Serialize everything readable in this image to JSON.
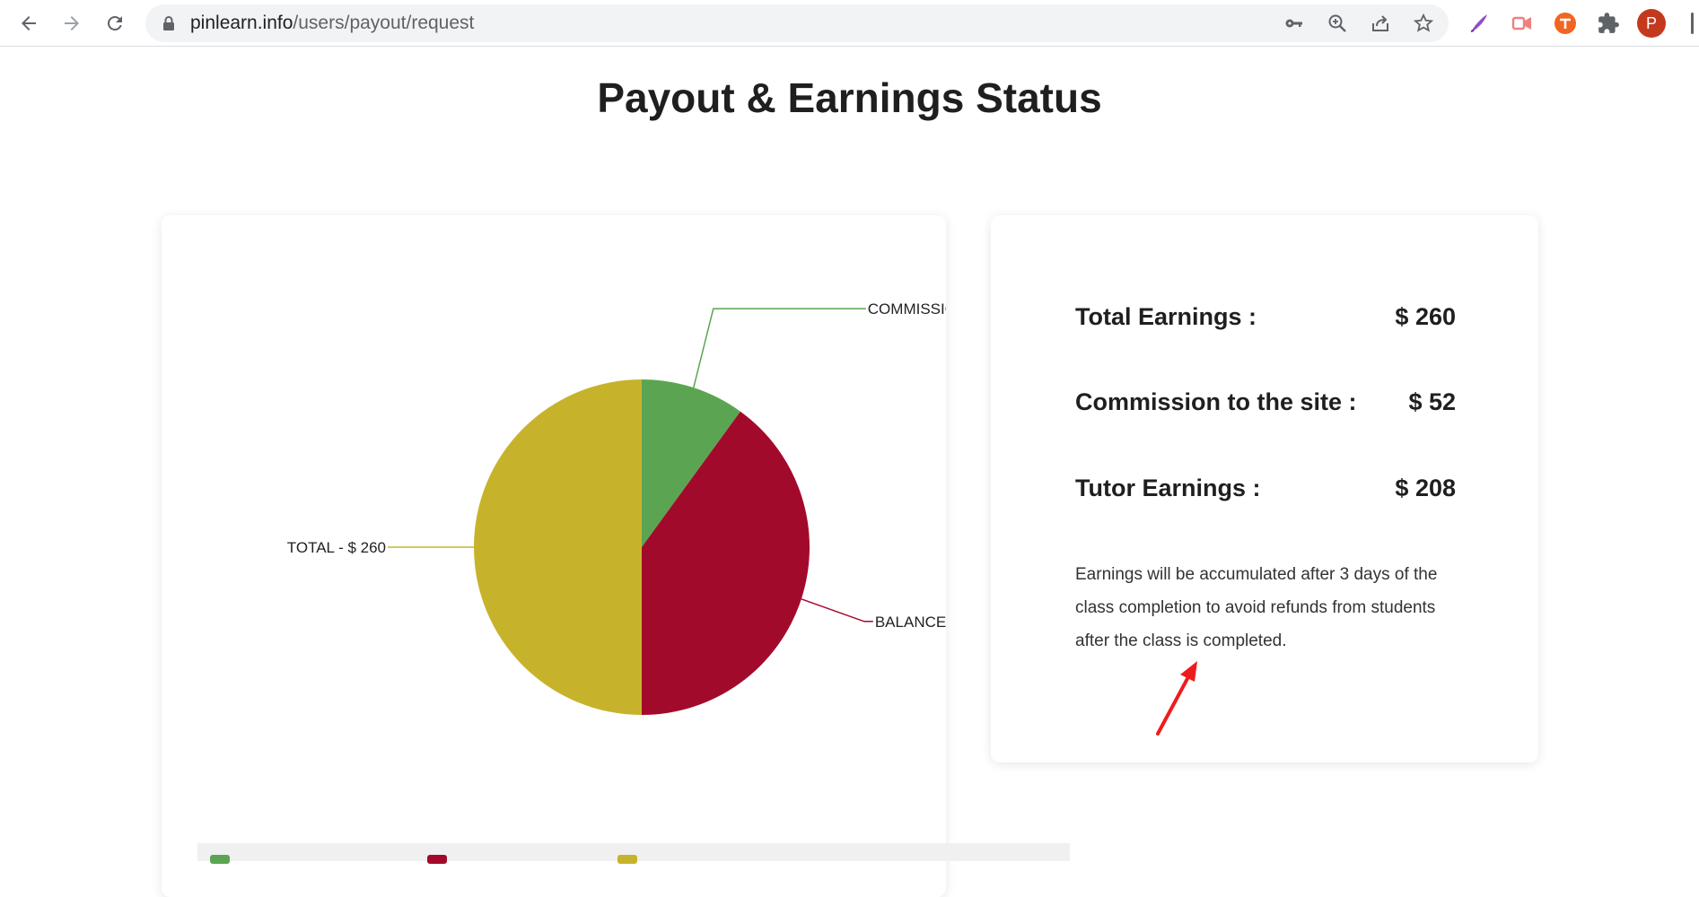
{
  "browser": {
    "url_host": "pinlearn.info",
    "url_path": "/users/payout/request",
    "avatar_letter": "P",
    "icons": [
      "back-icon",
      "forward-icon",
      "reload-icon",
      "lock-icon",
      "key-icon",
      "zoom-icon",
      "share-icon",
      "star-icon",
      "pen-extension-icon",
      "video-extension-icon",
      "t-extension-icon",
      "puzzle-extensions-icon"
    ]
  },
  "page": {
    "title": "Payout & Earnings Status"
  },
  "summary": {
    "rows": [
      {
        "label": "Total Earnings :",
        "value": "$ 260"
      },
      {
        "label": "Commission to the site :",
        "value": "$ 52"
      },
      {
        "label": "Tutor Earnings :",
        "value": "$ 208"
      }
    ],
    "note": "Earnings will be accumulated after 3 days of the class completion to avoid refunds from students after the class is completed."
  },
  "chart_data": {
    "type": "pie",
    "categories": [
      "COMMISSION",
      "BALANCE",
      "TOTAL"
    ],
    "values": [
      52,
      208,
      260
    ],
    "labels": [
      "COMMISSIO",
      "BALANCE - $",
      "TOTAL - $ 260"
    ],
    "colors": [
      "#5ba552",
      "#a20a2b",
      "#c7b32b"
    ]
  },
  "annotation": {
    "arrow_color": "#ee1c1c"
  }
}
